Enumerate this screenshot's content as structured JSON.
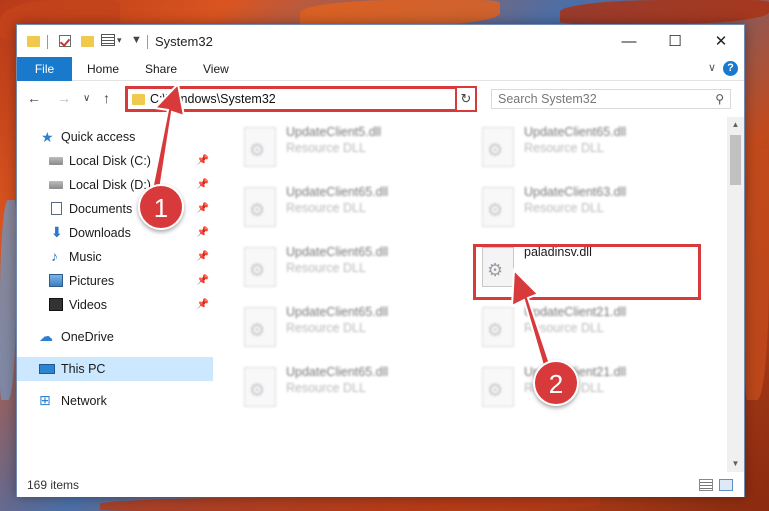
{
  "window": {
    "title": "System32",
    "minimize": "—",
    "maximize": "☐",
    "close": "✕"
  },
  "ribbon": {
    "tabs": [
      "File",
      "Home",
      "Share",
      "View"
    ],
    "help": "?",
    "collapse": "∨"
  },
  "address": {
    "path": "C:\\Windows\\System32",
    "dropdown": "∨",
    "refresh": "↻",
    "search_placeholder": "Search System32",
    "back": "←",
    "forward": "→",
    "recent": "∨",
    "up": "↑"
  },
  "sidebar": {
    "items": [
      {
        "label": "Quick access",
        "pinned": false
      },
      {
        "label": "Local Disk (C:)",
        "pinned": true
      },
      {
        "label": "Local Disk (D:)",
        "pinned": true
      },
      {
        "label": "Documents",
        "pinned": true
      },
      {
        "label": "Downloads",
        "pinned": true
      },
      {
        "label": "Music",
        "pinned": true
      },
      {
        "label": "Pictures",
        "pinned": true
      },
      {
        "label": "Videos",
        "pinned": true
      },
      {
        "label": "OneDrive",
        "pinned": false
      },
      {
        "label": "This PC",
        "pinned": false,
        "selected": true
      },
      {
        "label": "Network",
        "pinned": false
      }
    ],
    "pin_glyph": "📌"
  },
  "files": [
    {
      "name": "UpdateClient5.dll",
      "type": "Resource DLL"
    },
    {
      "name": "UpdateClient65.dll",
      "type": "Resource DLL"
    },
    {
      "name": "UpdateClient65.dll",
      "type": "Resource DLL"
    },
    {
      "name": "UpdateClient63.dll",
      "type": "Resource DLL"
    },
    {
      "name": "UpdateClient65.dll",
      "type": "Resource DLL"
    },
    {
      "name": "paladinsv.dll",
      "type": ""
    },
    {
      "name": "UpdateClient65.dll",
      "type": "Resource DLL"
    },
    {
      "name": "UpdateClient21.dll",
      "type": "Resource DLL"
    },
    {
      "name": "UpdateClient65.dll",
      "type": "Resource DLL"
    },
    {
      "name": "UpdateClient21.dll",
      "type": "Resource DLL"
    }
  ],
  "status": {
    "count": "169 items"
  },
  "annotations": {
    "step1": "1",
    "step2": "2",
    "color": "#d8393a"
  }
}
